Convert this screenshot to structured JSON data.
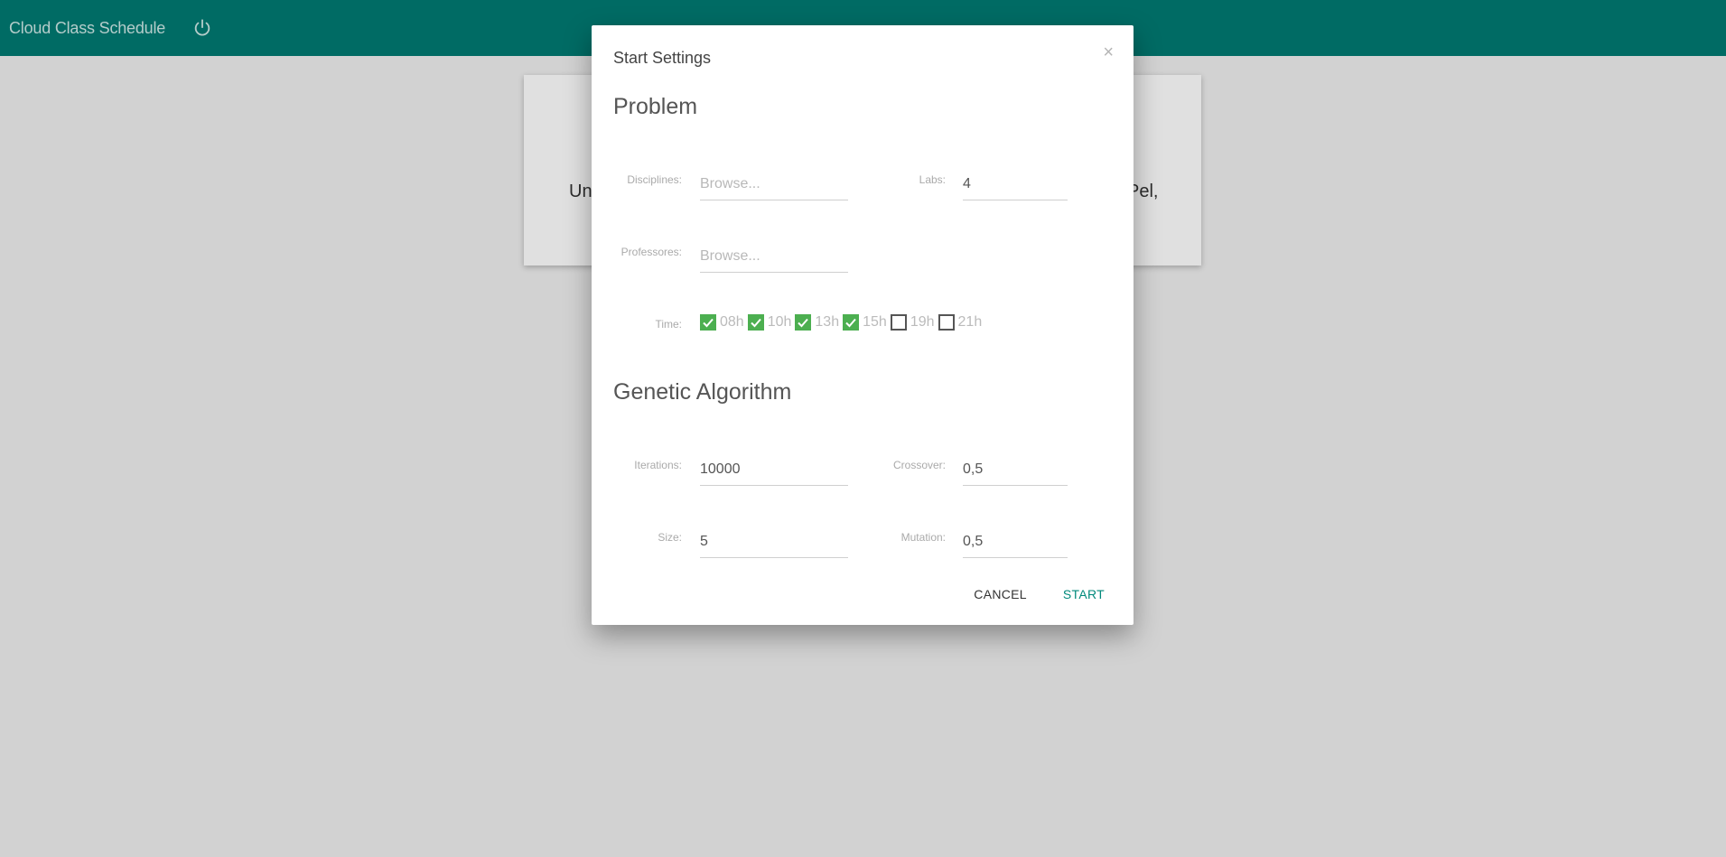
{
  "navbar": {
    "title": "Cloud Class Schedule",
    "bg_color": "#007a72"
  },
  "background_card": {
    "text_left": "Un",
    "text_right": "Pel,"
  },
  "modal": {
    "title": "Start Settings",
    "close_glyph": "×",
    "problem": {
      "title": "Problem",
      "disciplines_label": "Disciplines:",
      "disciplines_placeholder": "Browse...",
      "labs_label": "Labs:",
      "labs_value": "4",
      "professores_label": "Professores:",
      "professores_placeholder": "Browse...",
      "time_label": "Time:",
      "times": [
        {
          "label": "08h",
          "checked": true
        },
        {
          "label": "10h",
          "checked": true
        },
        {
          "label": "13h",
          "checked": true
        },
        {
          "label": "15h",
          "checked": true
        },
        {
          "label": "19h",
          "checked": false
        },
        {
          "label": "21h",
          "checked": false
        }
      ]
    },
    "genetic": {
      "title": "Genetic Algorithm",
      "iterations_label": "Iterations:",
      "iterations_value": "10000",
      "crossover_label": "Crossover:",
      "crossover_value": "0,5",
      "size_label": "Size:",
      "size_value": "5",
      "mutation_label": "Mutation:",
      "mutation_value": "0,5"
    },
    "buttons": {
      "cancel": "CANCEL",
      "start": "START"
    },
    "accent_color": "#00897b",
    "check_color": "#4caf50"
  }
}
